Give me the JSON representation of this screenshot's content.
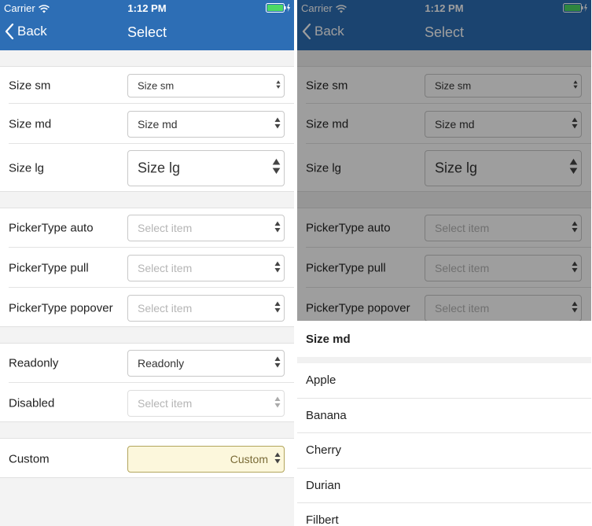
{
  "status_bar": {
    "carrier": "Carrier",
    "time": "1:12 PM"
  },
  "nav": {
    "back_label": "Back",
    "title": "Select"
  },
  "colors": {
    "nav_bar_left": "#2d6eb5",
    "nav_bar_right_dimmed": "#1f4b7c",
    "custom_select_bg": "#fcf7dc",
    "custom_select_border": "#b2a55c",
    "battery_green": "#4cd964"
  },
  "icons": {
    "back": "chevron-left-icon",
    "select": "up-down-arrows-icon",
    "wifi": "wifi-icon",
    "battery": "battery-icon",
    "charging": "bolt-icon"
  },
  "form": {
    "size_sm": {
      "label": "Size sm",
      "value": "Size sm"
    },
    "size_md": {
      "label": "Size md",
      "value": "Size md"
    },
    "size_lg": {
      "label": "Size lg",
      "value": "Size lg"
    },
    "picker_auto": {
      "label": "PickerType auto",
      "placeholder": "Select item"
    },
    "picker_pull": {
      "label": "PickerType pull",
      "placeholder": "Select item"
    },
    "picker_popover": {
      "label": "PickerType popover",
      "placeholder": "Select item"
    },
    "readonly": {
      "label": "Readonly",
      "value": "Readonly"
    },
    "disabled": {
      "label": "Disabled",
      "placeholder": "Select item"
    },
    "custom": {
      "label": "Custom",
      "value": "Custom"
    }
  },
  "picker": {
    "title": "Size md",
    "options": [
      "Apple",
      "Banana",
      "Cherry",
      "Durian",
      "Filbert"
    ]
  }
}
